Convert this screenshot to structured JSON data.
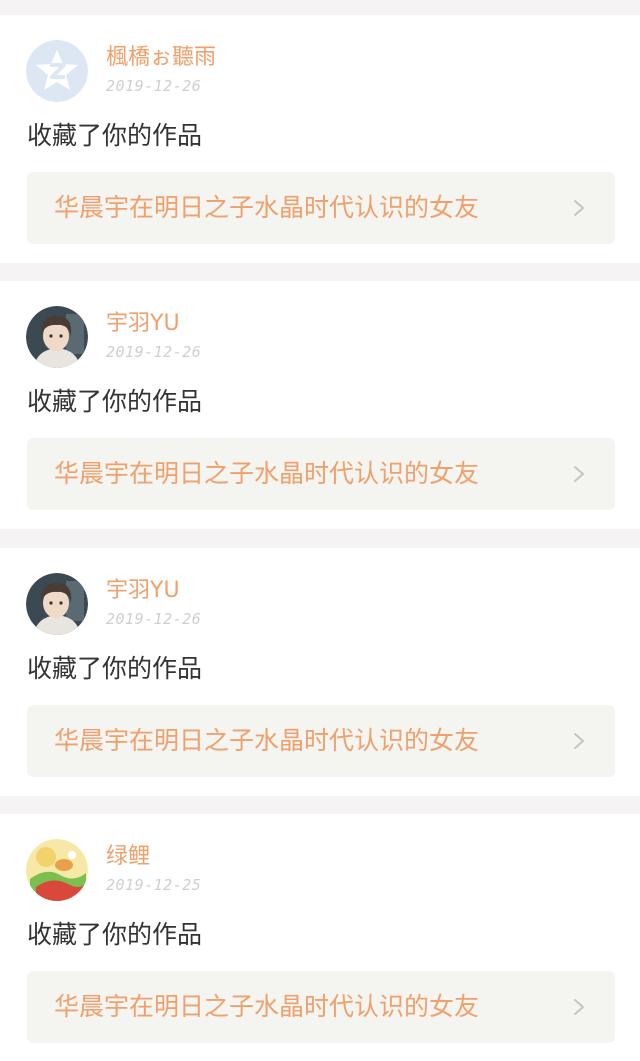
{
  "feed": {
    "items": [
      {
        "username": "楓橋ぉ聽雨",
        "date": "2019-12-26",
        "action": "收藏了你的作品",
        "work_title": "华晨宇在明日之子水晶时代认识的女友",
        "avatar_icon": "qzone-star-icon"
      },
      {
        "username": "宇羽YU",
        "date": "2019-12-26",
        "action": "收藏了你的作品",
        "work_title": "华晨宇在明日之子水晶时代认识的女友",
        "avatar_icon": "user-photo"
      },
      {
        "username": "宇羽YU",
        "date": "2019-12-26",
        "action": "收藏了你的作品",
        "work_title": "华晨宇在明日之子水晶时代认识的女友",
        "avatar_icon": "user-photo"
      },
      {
        "username": "绿鲤",
        "date": "2019-12-25",
        "action": "收藏了你的作品",
        "work_title": "华晨宇在明日之子水晶时代认识的女友",
        "avatar_icon": "illustrated-photo"
      }
    ]
  },
  "colors": {
    "accent": "#f0a06c",
    "text": "#333333",
    "date": "#cfcfcf",
    "link_bg": "#f4f4f0",
    "page_bg": "#f5f3f3"
  }
}
